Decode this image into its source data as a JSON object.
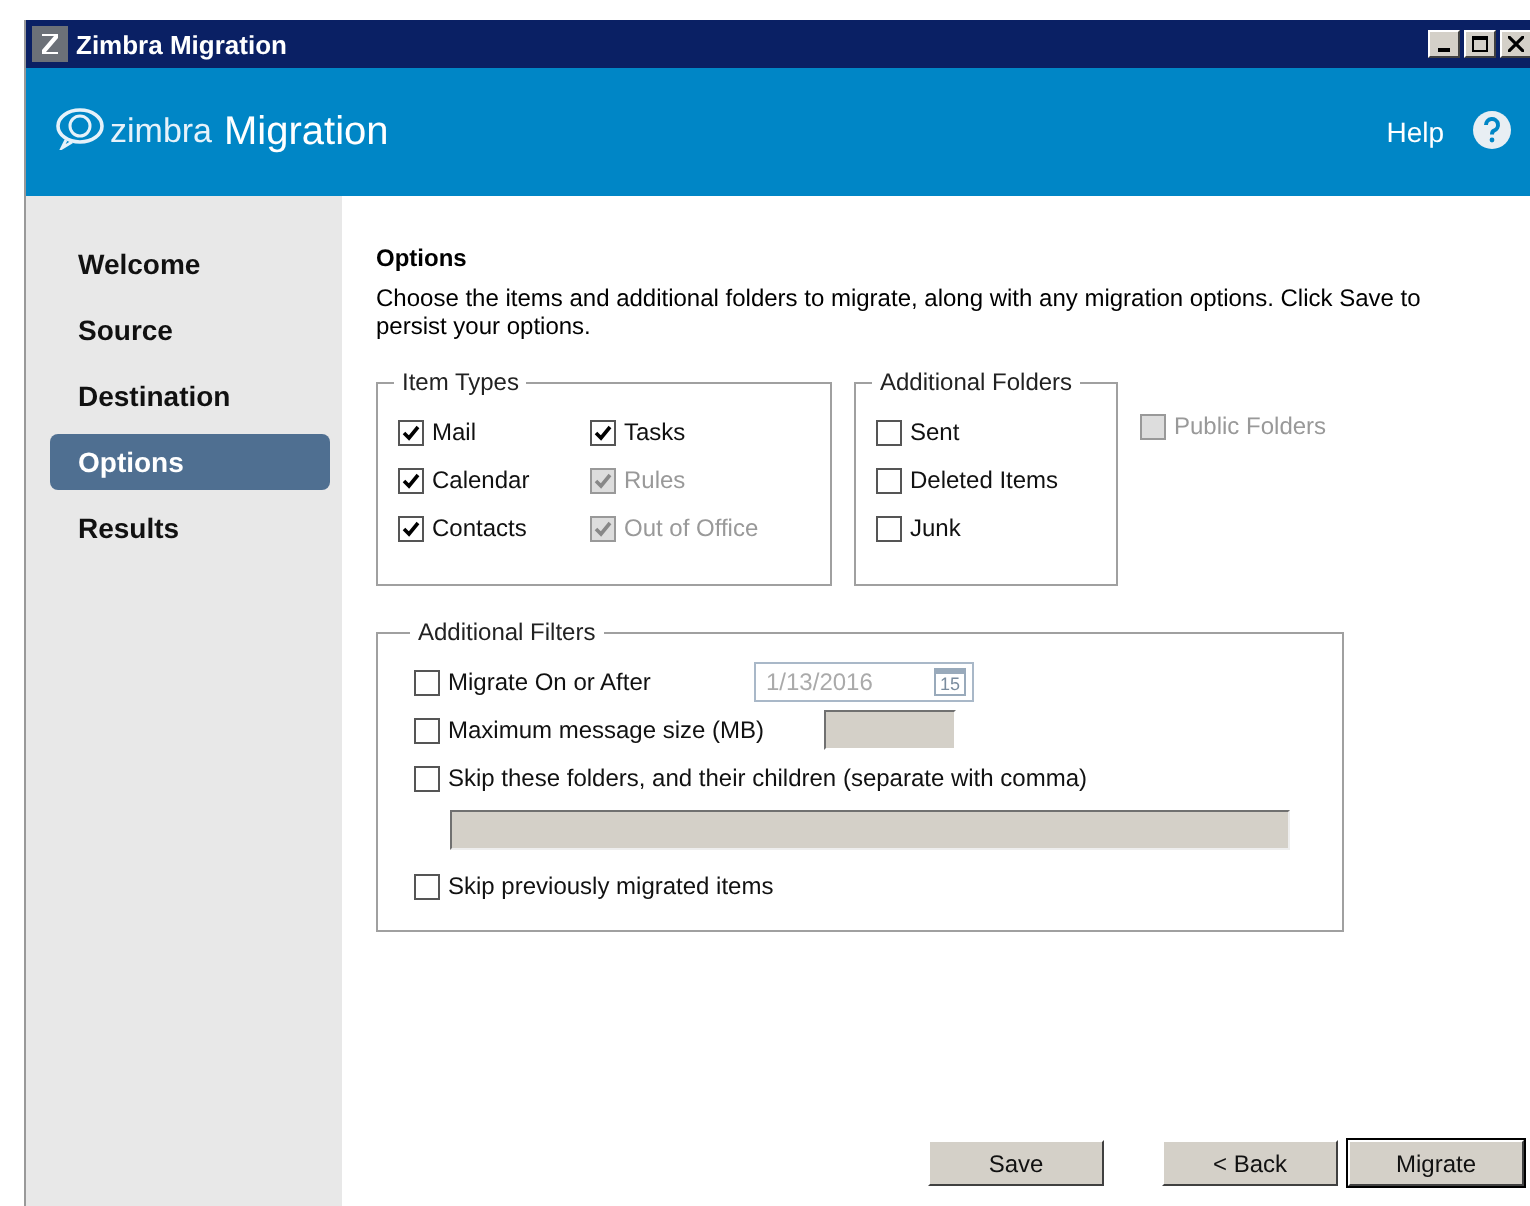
{
  "window": {
    "title": "Zimbra Migration"
  },
  "header": {
    "brand": "zimbra",
    "title": "Migration",
    "help": "Help"
  },
  "sidebar": {
    "items": [
      {
        "label": "Welcome",
        "selected": false
      },
      {
        "label": "Source",
        "selected": false
      },
      {
        "label": "Destination",
        "selected": false
      },
      {
        "label": "Options",
        "selected": true
      },
      {
        "label": "Results",
        "selected": false
      }
    ]
  },
  "options": {
    "title": "Options",
    "description": "Choose the items and additional folders to migrate, along with any migration options. Click Save to persist your options.",
    "item_types": {
      "title": "Item Types",
      "items": [
        {
          "label": "Mail",
          "checked": true,
          "disabled": false
        },
        {
          "label": "Calendar",
          "checked": true,
          "disabled": false
        },
        {
          "label": "Contacts",
          "checked": true,
          "disabled": false
        },
        {
          "label": "Tasks",
          "checked": true,
          "disabled": false
        },
        {
          "label": "Rules",
          "checked": true,
          "disabled": true
        },
        {
          "label": "Out of Office",
          "checked": true,
          "disabled": true
        }
      ]
    },
    "additional_folders": {
      "title": "Additional Folders",
      "items": [
        {
          "label": "Sent",
          "checked": false,
          "disabled": false
        },
        {
          "label": "Deleted Items",
          "checked": false,
          "disabled": false
        },
        {
          "label": "Junk",
          "checked": false,
          "disabled": false
        }
      ]
    },
    "public_folders": {
      "label": "Public Folders",
      "checked": false,
      "disabled": true
    },
    "additional_filters": {
      "title": "Additional Filters",
      "items": [
        {
          "kind": "date",
          "label": "Migrate On or After",
          "checked": false,
          "value": "1/13/2016",
          "day": "15"
        },
        {
          "kind": "number",
          "label": "Maximum message size (MB)",
          "checked": false
        },
        {
          "kind": "text",
          "label": "Skip these folders, and their children (separate with comma)",
          "checked": false
        },
        {
          "kind": "plain",
          "label": "Skip previously migrated items",
          "checked": false
        }
      ]
    }
  },
  "buttons": [
    {
      "label": "Save",
      "default": false
    },
    {
      "label": "< Back",
      "default": false
    },
    {
      "label": "Migrate",
      "default": true
    }
  ]
}
